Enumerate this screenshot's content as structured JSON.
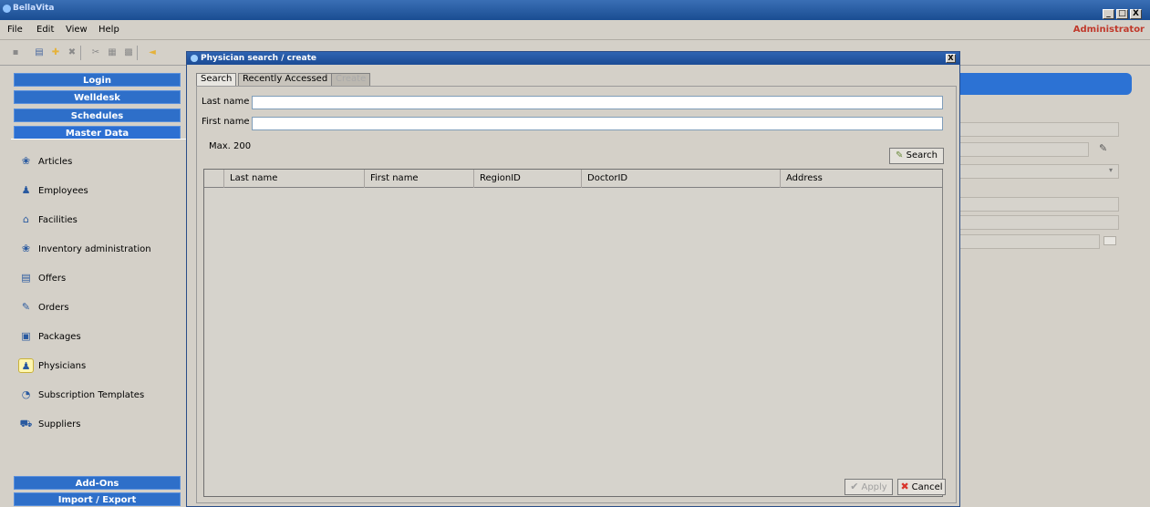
{
  "app": {
    "title": "BellaVita",
    "user": "Administrator",
    "window_buttons": [
      "_",
      "□",
      "X"
    ]
  },
  "menu": [
    {
      "label": "File"
    },
    {
      "label": "Edit"
    },
    {
      "label": "View"
    },
    {
      "label": "Help"
    }
  ],
  "sidebar": {
    "nav": {
      "login": "Login",
      "welldesk": "Welldesk",
      "schedules": "Schedules",
      "master_data": "Master Data",
      "addons": "Add-Ons",
      "import_export": "Import / Export"
    },
    "items": [
      {
        "label": "Articles",
        "icon": "articles-icon"
      },
      {
        "label": "Employees",
        "icon": "employees-icon"
      },
      {
        "label": "Facilities",
        "icon": "facilities-icon"
      },
      {
        "label": "Inventory administration",
        "icon": "inventory-icon"
      },
      {
        "label": "Offers",
        "icon": "offers-icon"
      },
      {
        "label": "Orders",
        "icon": "orders-icon"
      },
      {
        "label": "Packages",
        "icon": "packages-icon"
      },
      {
        "label": "Physicians",
        "icon": "physicians-icon",
        "selected": true
      },
      {
        "label": "Subscription Templates",
        "icon": "subscription-icon"
      },
      {
        "label": "Suppliers",
        "icon": "suppliers-icon"
      }
    ]
  },
  "dialog": {
    "title": "Physician search / create",
    "close": "X",
    "tabs": [
      {
        "label": "Search",
        "active": true
      },
      {
        "label": "Recently Accessed",
        "active": false
      },
      {
        "label": "Create",
        "disabled": true
      }
    ],
    "fields": {
      "last_name_label": "Last name",
      "last_name_value": "",
      "first_name_label": "First name",
      "first_name_value": ""
    },
    "max_label": "Max. 200",
    "search_label": "Search",
    "grid": {
      "columns": [
        "Last name",
        "First name",
        "RegionID",
        "DoctorID",
        "Address"
      ]
    },
    "apply_label": "Apply",
    "cancel_label": "Cancel"
  },
  "colors": {
    "nav_blue": "#2e6fc9",
    "title_blue": "#1a4d92",
    "admin_red": "#c0392b",
    "cancel_red": "#d9342b"
  }
}
